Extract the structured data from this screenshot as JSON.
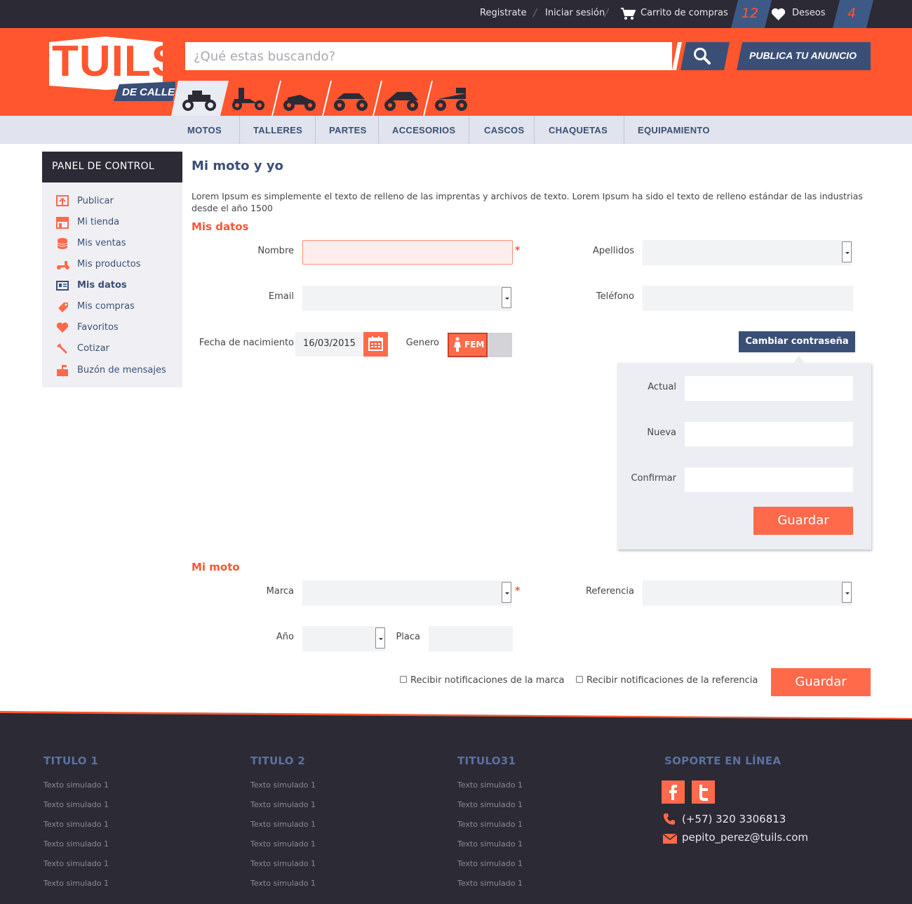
{
  "topbar": {
    "register": "Registrate",
    "login": "Iniciar sesión",
    "cart": "Carrito de compras",
    "cart_count": "12",
    "wishes": "Deseos",
    "wishes_count": "4"
  },
  "header": {
    "logo_main": "TUILS",
    "logo_sub": "DE CALLE",
    "search_placeholder": "¿Qué estas buscando?",
    "publish": "PUBLICA TU ANUNCIO",
    "categories": [
      "motorcycle-icon",
      "scooter-icon",
      "dirtbike-icon",
      "cruiser-icon",
      "sportbike-icon",
      "touring-icon"
    ]
  },
  "nav": [
    "MOTOS",
    "TALLERES",
    "PARTES",
    "ACCESORIOS",
    "CASCOS",
    "CHAQUETAS",
    "EQUIPAMIENTO"
  ],
  "sidebar": {
    "title": "PANEL DE CONTROL",
    "items": [
      {
        "label": "Publicar",
        "icon": "upload-icon"
      },
      {
        "label": "Mi tienda",
        "icon": "store-icon"
      },
      {
        "label": "Mis ventas",
        "icon": "coins-icon"
      },
      {
        "label": "Mis productos",
        "icon": "scooter-icon"
      },
      {
        "label": "Mis datos",
        "icon": "id-card-icon"
      },
      {
        "label": "Mis compras",
        "icon": "tag-icon"
      },
      {
        "label": "Favoritos",
        "icon": "heart-icon"
      },
      {
        "label": "Cotizar",
        "icon": "wrench-icon"
      },
      {
        "label": "Buzón de mensajes",
        "icon": "mailbox-icon"
      }
    ]
  },
  "main": {
    "title": "Mi moto y yo",
    "intro": "Lorem Ipsum es simplemente el texto de relleno de las imprentas y archivos de texto. Lorem Ipsum ha sido el texto de relleno estándar de las industrias desde el año 1500",
    "mis_datos": {
      "heading": "Mis datos",
      "nombre": "Nombre",
      "apellidos": "Apellidos",
      "email": "Email",
      "telefono": "Teléfono",
      "fecha": "Fecha de nacimiento",
      "fecha_value": "16/03/2015",
      "genero": "Genero",
      "genero_value": "FEM",
      "required": "*"
    },
    "password": {
      "button": "Cambiar contraseña",
      "actual": "Actual",
      "nueva": "Nueva",
      "confirmar": "Confirmar",
      "save": "Guardar"
    },
    "mi_moto": {
      "heading": "Mi moto",
      "marca": "Marca",
      "referencia": "Referencia",
      "anio": "Año",
      "placa": "Placa",
      "notif_marca": "Recibir notificaciones de la marca",
      "notif_ref": "Recibir notificaciones de la referencia",
      "save": "Guardar",
      "required": "*"
    }
  },
  "footer": {
    "columns": [
      {
        "title": "TITULO 1",
        "links": [
          "Texto simulado 1",
          "Texto simulado 1",
          "Texto simulado 1",
          "Texto simulado 1",
          "Texto simulado 1",
          "Texto simulado 1"
        ]
      },
      {
        "title": "TITULO 2",
        "links": [
          "Texto simulado 1",
          "Texto simulado 1",
          "Texto simulado 1",
          "Texto simulado 1",
          "Texto simulado 1",
          "Texto simulado 1"
        ]
      },
      {
        "title": "TITULO31",
        "links": [
          "Texto simulado 1",
          "Texto simulado 1",
          "Texto simulado 1",
          "Texto simulado 1",
          "Texto simulado 1",
          "Texto simulado 1"
        ]
      }
    ],
    "support_title": "SOPORTE EN LÍNEA",
    "phone": "(+57) 320 3306813",
    "email": "pepito_perez@tuils.com"
  },
  "colors": {
    "accent": "#ff5630",
    "navy": "#3a4f76",
    "dark": "#2b2a35"
  }
}
